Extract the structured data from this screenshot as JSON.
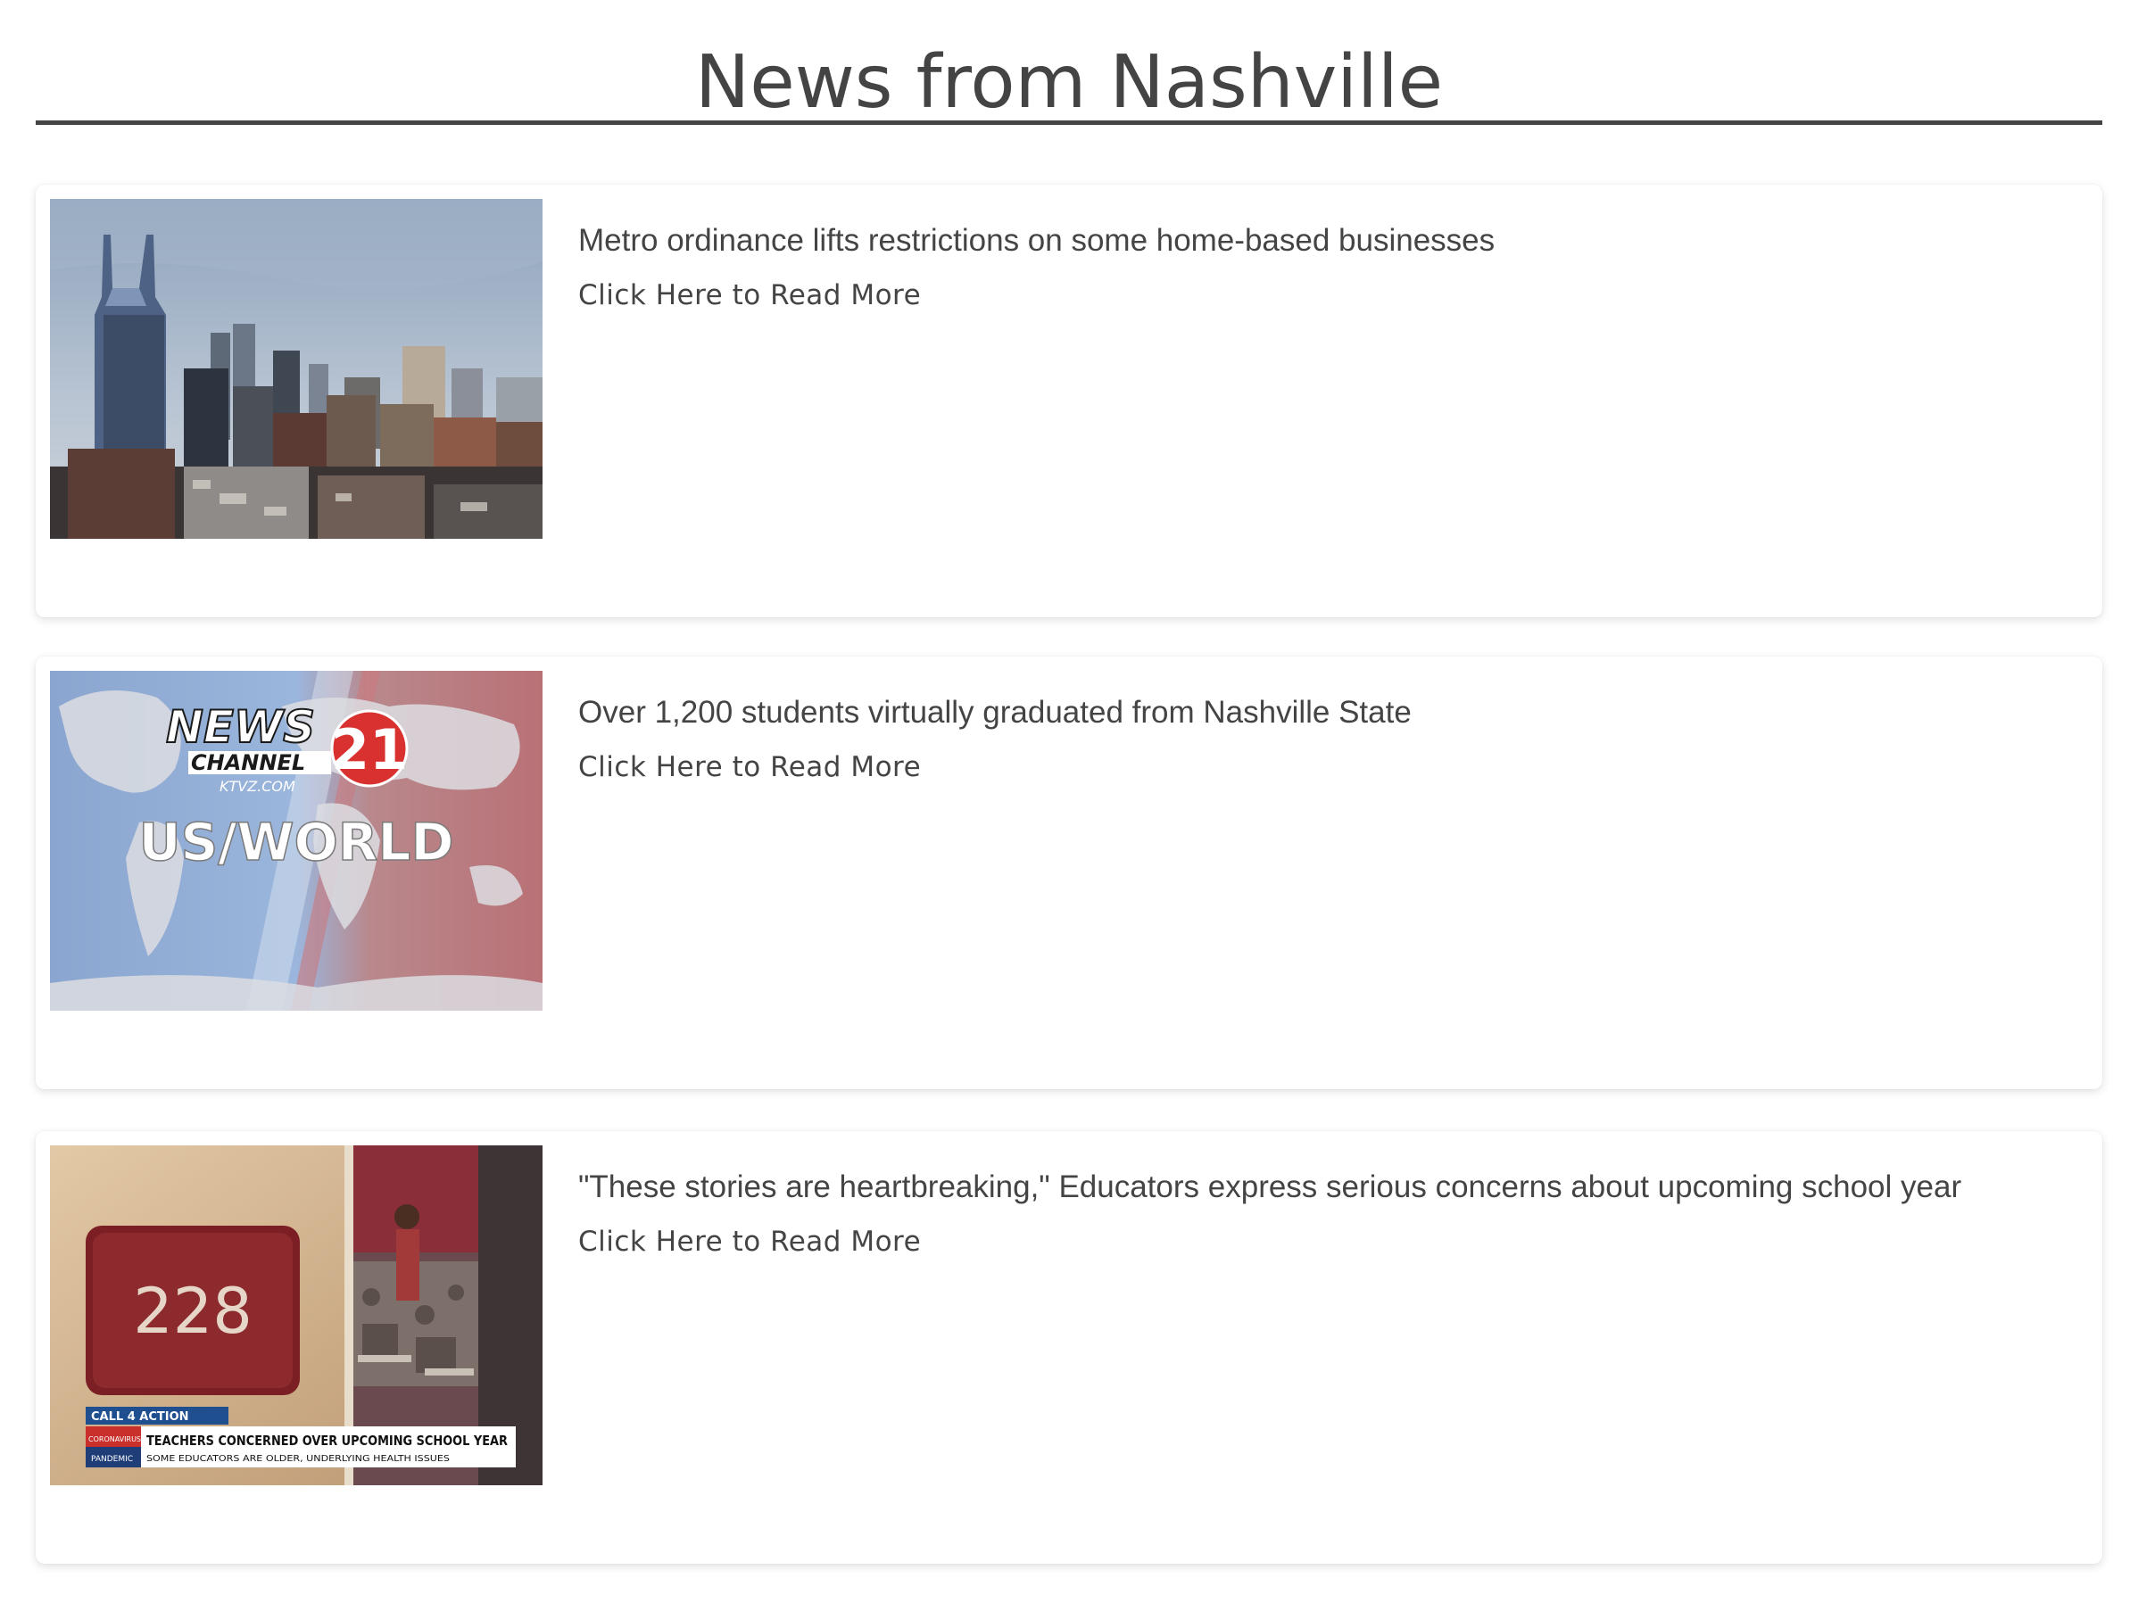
{
  "page": {
    "title": "News from Nashville"
  },
  "articles": [
    {
      "headline": "Metro ordinance lifts restrictions on some home-based businesses",
      "link_label": "Click Here to Read More",
      "image": "nashville-skyline-photo"
    },
    {
      "headline": "Over 1,200 students virtually graduated from Nashville State",
      "link_label": "Click Here to Read More",
      "image": "newschannel21-us-world-graphic",
      "image_text": {
        "brand_top": "NEWS",
        "brand_number": "21",
        "brand_mid": "CHANNEL",
        "brand_site": "KTVZ.COM",
        "section": "US/WORLD"
      }
    },
    {
      "headline": "\"These stories are heartbreaking,\" Educators express serious concerns about upcoming school year",
      "link_label": "Click Here to Read More",
      "image": "classroom-door-228-photo",
      "image_text": {
        "room_number": "228",
        "tag": "CALL 4 ACTION",
        "side_label_1": "CORONAVIRUS",
        "side_label_2": "PANDEMIC",
        "chyron_main": "TEACHERS CONCERNED OVER UPCOMING SCHOOL YEAR",
        "chyron_sub": "SOME EDUCATORS ARE OLDER, UNDERLYING HEALTH ISSUES"
      }
    }
  ],
  "colors": {
    "text": "#444444",
    "rule": "#444444",
    "card_bg": "#ffffff"
  }
}
